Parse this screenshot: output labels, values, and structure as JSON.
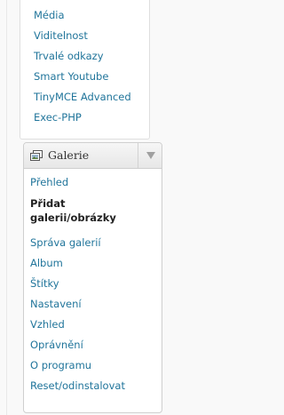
{
  "top_menu": {
    "items": [
      {
        "label": "Média"
      },
      {
        "label": "Viditelnost"
      },
      {
        "label": "Trvalé odkazy"
      },
      {
        "label": "Smart Youtube"
      },
      {
        "label": "TinyMCE Advanced"
      },
      {
        "label": "Exec-PHP"
      }
    ]
  },
  "galerie_menu": {
    "title": "Galerie",
    "icon": "gallery-icon",
    "toggle_icon": "triangle-down-icon",
    "items": [
      {
        "label": "Přehled"
      },
      {
        "label": "Přidat galerii/obrázky",
        "label_line1": "Přidat",
        "label_line2": "galerii/obrázky",
        "current": true
      },
      {
        "label": "Správa galerií"
      },
      {
        "label": "Album"
      },
      {
        "label": "Štítky"
      },
      {
        "label": "Nastavení"
      },
      {
        "label": "Vzhled"
      },
      {
        "label": "Oprávnění"
      },
      {
        "label": "O programu"
      },
      {
        "label": "Reset/odinstalovat"
      }
    ]
  },
  "colors": {
    "link": "#21759b",
    "current_item": "#222222",
    "background": "#f9f9f9",
    "panel_border": "#dfdfdf",
    "header_gradient_top": "#f6f6f6",
    "header_gradient_bottom": "#e7e7e7"
  }
}
